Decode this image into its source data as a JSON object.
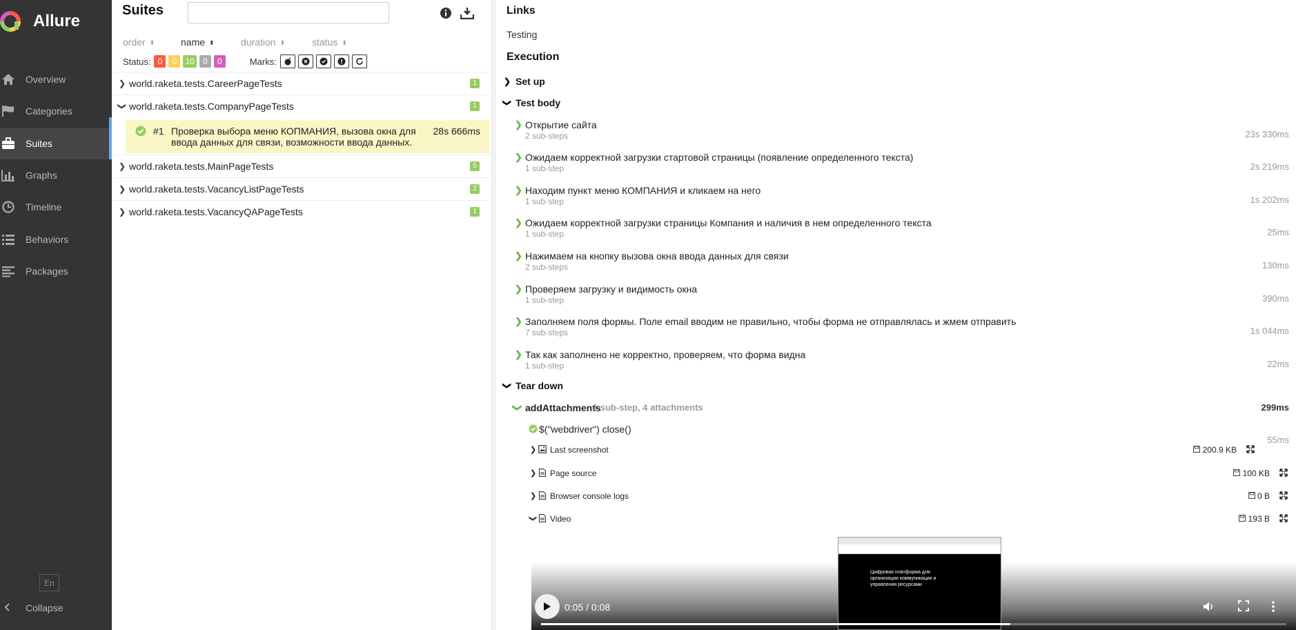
{
  "app": {
    "title": "Allure"
  },
  "sidebar": {
    "items": [
      {
        "label": "Overview",
        "icon": "home-icon"
      },
      {
        "label": "Categories",
        "icon": "flag-icon"
      },
      {
        "label": "Suites",
        "icon": "briefcase-icon",
        "active": true
      },
      {
        "label": "Graphs",
        "icon": "bar-chart-icon"
      },
      {
        "label": "Timeline",
        "icon": "clock-icon"
      },
      {
        "label": "Behaviors",
        "icon": "list-icon"
      },
      {
        "label": "Packages",
        "icon": "align-left-icon"
      }
    ],
    "language": "En",
    "collapse_label": "Collapse"
  },
  "suites": {
    "title": "Suites",
    "search_value": "",
    "sorters": {
      "order": "order",
      "name": "name",
      "duration": "duration",
      "status": "status"
    },
    "status_label": "Status:",
    "status_counts": [
      {
        "value": "0",
        "color": "#fd5a3e"
      },
      {
        "value": "0",
        "color": "#ffd050"
      },
      {
        "value": "10",
        "color": "#97cc64"
      },
      {
        "value": "0",
        "color": "#aaaaaa"
      },
      {
        "value": "0",
        "color": "#d35ebe"
      }
    ],
    "marks_label": "Marks:",
    "groups": [
      {
        "name": "world.raketa.tests.CareerPageTests",
        "count": "1",
        "expanded": false
      },
      {
        "name": "world.raketa.tests.CompanyPageTests",
        "count": "1",
        "expanded": true
      },
      {
        "name": "world.raketa.tests.MainPageTests",
        "count": "5",
        "expanded": false
      },
      {
        "name": "world.raketa.tests.VacancyListPageTests",
        "count": "2",
        "expanded": false
      },
      {
        "name": "world.raketa.tests.VacancyQAPageTests",
        "count": "1",
        "expanded": false
      }
    ],
    "selected_case": {
      "number": "#1",
      "title": "Проверка выбора меню КОПМАНИЯ, вызова окна для ввода данных для связи, возможности ввода данных.",
      "duration": "28s 666ms"
    }
  },
  "details": {
    "links_heading": "Links",
    "link": "Testing",
    "execution_heading": "Execution",
    "setup_label": "Set up",
    "testbody_label": "Test body",
    "teardown_label": "Tear down",
    "steps": [
      {
        "title": "Открытие сайта",
        "sub": "2 sub-steps",
        "duration": "23s 330ms"
      },
      {
        "title": "Ожидаем корректной загрузки стартовой страницы (появление определенного текста)",
        "sub": "1 sub-step",
        "duration": "2s 219ms"
      },
      {
        "title": "Находим пункт меню КОМПАНИЯ и кликаем на него",
        "sub": "1 sub-step",
        "duration": "1s 202ms"
      },
      {
        "title": "Ожидаем корректной загрузки страницы Компания и наличия в нем определенного текста",
        "sub": "1 sub-step",
        "duration": "25ms"
      },
      {
        "title": "Нажимаем на кнопку вызова окна ввода данных для связи",
        "sub": "2 sub-steps",
        "duration": "130ms"
      },
      {
        "title": "Проверяем загрузку и видимость окна",
        "sub": "1 sub-step",
        "duration": "390ms"
      },
      {
        "title": "Заполняем поля формы. Поле email вводим не правильно, чтобы форма не отправлялась и жмем отправить",
        "sub": "7 sub-steps",
        "duration": "1s 044ms"
      },
      {
        "title": "Так как заполнено не корректно, проверяем, что форма видна",
        "sub": "1 sub-step",
        "duration": "22ms"
      }
    ],
    "teardown": {
      "name": "addAttachments",
      "meta": "1 sub-step, 4 attachments",
      "duration": "299ms",
      "substep": {
        "title": "$(\"webdriver\") close()",
        "duration": "55ms"
      },
      "attachments": [
        {
          "name": "Last screenshot",
          "size": "200.9 KB",
          "icon": "image-icon"
        },
        {
          "name": "Page source",
          "size": "100 KB",
          "icon": "file-icon"
        },
        {
          "name": "Browser console logs",
          "size": "0 B",
          "icon": "file-icon"
        },
        {
          "name": "Video",
          "size": "193 B",
          "icon": "file-icon"
        }
      ]
    },
    "video": {
      "time": "0:05 / 0:08",
      "progress": 0.63,
      "thumb_text": "Цифровая платформа для организации коммуникации и управления ресурсами"
    }
  }
}
